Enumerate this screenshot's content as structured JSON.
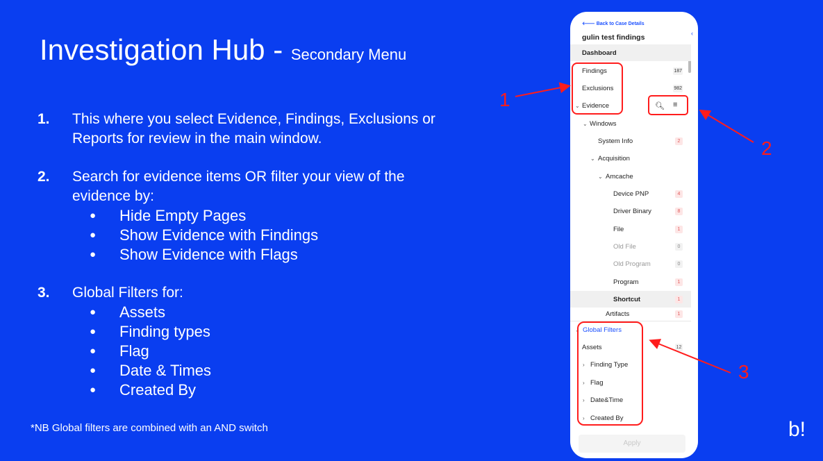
{
  "slide": {
    "title": "Investigation Hub",
    "title_sep": " - ",
    "subtitle": "Secondary Menu",
    "steps": [
      {
        "num": "1.",
        "text": "This where you select Evidence, Findings, Exclusions or Reports for review in the main window.",
        "bullets": []
      },
      {
        "num": "2.",
        "text": "Search for evidence items OR filter your view of the evidence by:",
        "bullets": [
          "Hide Empty Pages",
          "Show Evidence with Findings",
          "Show Evidence with Flags"
        ]
      },
      {
        "num": "3.",
        "text": "Global Filters for:",
        "bullets": [
          "Assets",
          "Finding types",
          "Flag",
          "Date & Times",
          "Created By"
        ]
      }
    ],
    "note": "*NB Global filters are combined with an AND switch",
    "logo": "b!",
    "callouts": [
      "1",
      "2",
      "3"
    ],
    "accent_color": "#ff1c1c",
    "bg_color": "#0a3ef0"
  },
  "panel": {
    "back_link": "Back to Case Details",
    "case_title": "gulin test findings",
    "nav": [
      {
        "label": "Dashboard",
        "count": ""
      },
      {
        "label": "Findings",
        "count": "187"
      },
      {
        "label": "Exclusions",
        "count": "982"
      },
      {
        "label": "Evidence",
        "count": ""
      }
    ],
    "tree": [
      {
        "label": "Windows",
        "count": ""
      },
      {
        "label": "System Info",
        "count": "2"
      },
      {
        "label": "Acquisition",
        "count": ""
      },
      {
        "label": "Amcache",
        "count": ""
      },
      {
        "label": "Device PNP",
        "count": "4"
      },
      {
        "label": "Driver Binary",
        "count": "8"
      },
      {
        "label": "File",
        "count": "1"
      },
      {
        "label": "Old File",
        "count": "0"
      },
      {
        "label": "Old Program",
        "count": "0"
      },
      {
        "label": "Program",
        "count": "1"
      },
      {
        "label": "Shortcut",
        "count": "1"
      },
      {
        "label": "Artifacts",
        "count": "1"
      }
    ],
    "global_filters": {
      "header": "Global Filters",
      "items": [
        {
          "label": "Assets",
          "count": "12"
        },
        {
          "label": "Finding Type",
          "count": ""
        },
        {
          "label": "Flag",
          "count": ""
        },
        {
          "label": "Date&Time",
          "count": ""
        },
        {
          "label": "Created By",
          "count": ""
        }
      ]
    },
    "apply_label": "Apply",
    "icons": [
      "back-arrow-icon",
      "collapse-chevron-icon",
      "search-icon",
      "filter-icon",
      "chevron-down-icon",
      "chevron-right-icon"
    ]
  }
}
